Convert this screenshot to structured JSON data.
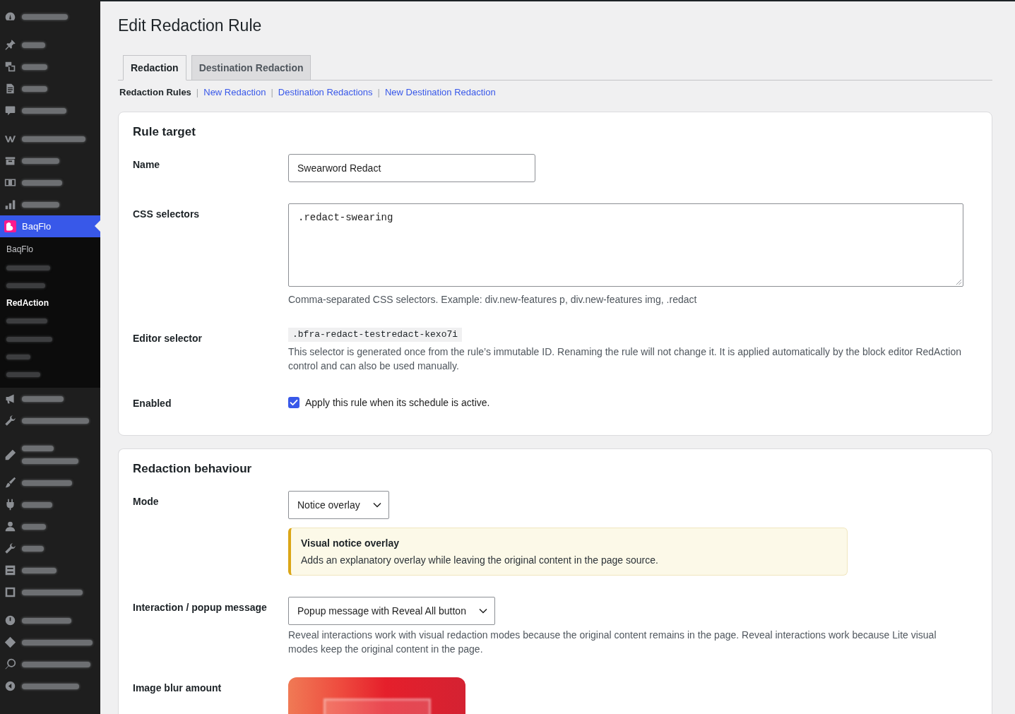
{
  "sidebar": {
    "groups": [
      [
        {
          "selected": false,
          "blurred": true
        }
      ],
      [
        {
          "selected": false,
          "blurred": true
        },
        {
          "selected": false,
          "blurred": true
        },
        {
          "selected": false,
          "blurred": true
        },
        {
          "selected": false,
          "blurred": true
        }
      ],
      [
        {
          "selected": false,
          "blurred": true
        },
        {
          "selected": false,
          "blurred": true
        },
        {
          "selected": false,
          "blurred": true
        },
        {
          "selected": false,
          "blurred": true
        },
        {
          "label": "BaqFlo",
          "selected": true,
          "blurred": false,
          "children": [
            {
              "label": "BaqFlo",
              "selected": false,
              "blurred": false
            },
            {
              "selected": false,
              "blurred": true
            },
            {
              "selected": false,
              "blurred": true
            },
            {
              "label": "RedAction",
              "selected": true,
              "blurred": false
            },
            {
              "selected": false,
              "blurred": true
            },
            {
              "selected": false,
              "blurred": true
            },
            {
              "selected": false,
              "blurred": true
            },
            {
              "selected": false,
              "blurred": true
            }
          ]
        },
        {
          "selected": false,
          "blurred": true
        },
        {
          "selected": false,
          "blurred": true
        }
      ],
      [
        {
          "selected": false,
          "blurred": true
        },
        {
          "selected": false,
          "blurred": true
        },
        {
          "selected": false,
          "blurred": true
        },
        {
          "selected": false,
          "blurred": true
        },
        {
          "selected": false,
          "blurred": true
        },
        {
          "selected": false,
          "blurred": true
        },
        {
          "selected": false,
          "blurred": true
        }
      ],
      [
        {
          "selected": false,
          "blurred": true
        },
        {
          "selected": false,
          "blurred": true
        },
        {
          "selected": false,
          "blurred": true
        },
        {
          "selected": false,
          "blurred": true
        }
      ]
    ]
  },
  "page_title": "Edit Redaction Rule",
  "tabs": [
    {
      "label": "Redaction",
      "selected": true
    },
    {
      "label": "Destination Redaction",
      "selected": false
    }
  ],
  "subnav": [
    {
      "label": "Redaction Rules",
      "selected": true
    },
    {
      "separator": "|",
      "label": "New Redaction",
      "selected": false
    },
    {
      "separator": "|",
      "label": "Destination Redactions",
      "selected": false
    },
    {
      "separator": "|",
      "label": "New Destination Redaction",
      "selected": false
    }
  ],
  "sections": [
    {
      "title": "Rule target",
      "rows": [
        {
          "kind": "text",
          "label": "Name",
          "value": "Swearword Redact"
        },
        {
          "kind": "textarea",
          "label": "CSS selectors",
          "value": ".redact-swearing",
          "help": "Comma-separated CSS selectors. Example: div.new-features p, div.new-features img, .redact"
        },
        {
          "kind": "code",
          "label": "Editor selector",
          "code": ".bfra-redact-testredact-kexo7i",
          "help": "This selector is generated once from the rule’s immutable ID. Renaming the rule will not change it. It is applied automatically by the block editor RedAction control and can also be used manually."
        },
        {
          "kind": "checkbox",
          "label": "Enabled",
          "checked": true,
          "text": "Apply this rule when its schedule is active."
        }
      ]
    },
    {
      "title": "Redaction behaviour",
      "rows": [
        {
          "kind": "select",
          "label": "Mode",
          "value": "Notice overlay",
          "notice": {
            "title": "Visual notice overlay",
            "text": "Adds an explanatory overlay while leaving the original content in the page source."
          }
        },
        {
          "kind": "select",
          "label": "Interaction / popup message",
          "value": "Popup message with Reveal All button",
          "help": "Reveal interactions work with visual redaction modes because the original content remains in the page. Reveal interactions work because Lite visual modes keep the original content in the page."
        },
        {
          "kind": "image",
          "label": "Image blur amount"
        }
      ]
    }
  ]
}
